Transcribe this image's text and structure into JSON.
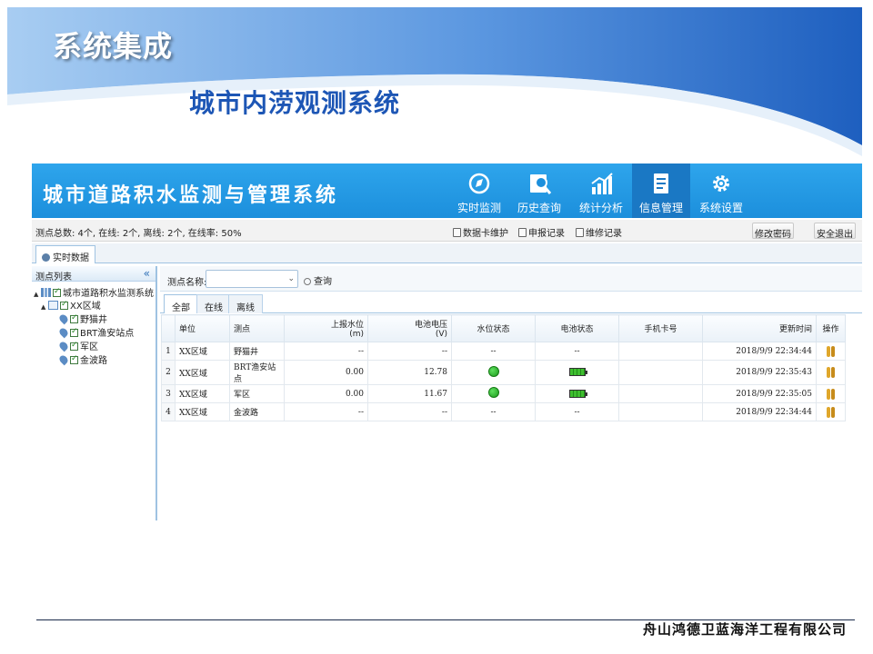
{
  "slide": {
    "title": "系统集成",
    "subtitle": "城市内涝观测系统",
    "company": "舟山鸿德卫蓝海洋工程有限公司"
  },
  "app": {
    "title": "城市道路积水监测与管理系统",
    "nav": [
      {
        "label": "实时监测",
        "icon": "compass-icon"
      },
      {
        "label": "历史查询",
        "icon": "search-user-icon"
      },
      {
        "label": "统计分析",
        "icon": "bar-chart-icon"
      },
      {
        "label": "信息管理",
        "icon": "document-icon",
        "active": true
      },
      {
        "label": "系统设置",
        "icon": "gear-icon"
      }
    ],
    "status_text": "测点总数: 4个, 在线: 2个, 离线: 2个, 在线率: 50%",
    "links": {
      "card_maintain": "数据卡维护",
      "report_record": "申报记录",
      "repair_record": "维修记录"
    },
    "buttons": {
      "change_password": "修改密码",
      "logout": "安全退出"
    },
    "main_tab": "实时数据",
    "tree": {
      "title": "测点列表",
      "collapse": "«",
      "root": "城市道路积水监测系统",
      "region": "XX区域",
      "points": [
        "野猫井",
        "BRT渔安站点",
        "军区",
        "金波路"
      ]
    },
    "search": {
      "label": "测点名称:",
      "value": "",
      "button": "查询"
    },
    "filter_tabs": [
      "全部",
      "在线",
      "离线"
    ],
    "table": {
      "columns": [
        "",
        "单位",
        "测点",
        "上报水位\n(m)",
        "电池电压\n(V)",
        "水位状态",
        "电池状态",
        "手机卡号",
        "更新时间",
        "操作"
      ],
      "rows": [
        {
          "idx": "1",
          "unit": "XX区域",
          "point": "野猫井",
          "level": "--",
          "voltage": "--",
          "water_status": "--",
          "battery_status": "--",
          "sim": "",
          "time": "2018/9/9 22:34:44"
        },
        {
          "idx": "2",
          "unit": "XX区域",
          "point": "BRT渔安站点",
          "level": "0.00",
          "voltage": "12.78",
          "water_status": "green",
          "battery_status": "full",
          "sim": "",
          "time": "2018/9/9 22:35:43"
        },
        {
          "idx": "3",
          "unit": "XX区域",
          "point": "军区",
          "level": "0.00",
          "voltage": "11.67",
          "water_status": "green",
          "battery_status": "full",
          "sim": "",
          "time": "2018/9/9 22:35:05"
        },
        {
          "idx": "4",
          "unit": "XX区域",
          "point": "金波路",
          "level": "--",
          "voltage": "--",
          "water_status": "--",
          "battery_status": "--",
          "sim": "",
          "time": "2018/9/9 22:34:44"
        }
      ]
    }
  },
  "colors": {
    "header_blue": "#1c8fdc",
    "nav_active": "#1a78c4",
    "subtitle_blue": "#1d56b5"
  }
}
